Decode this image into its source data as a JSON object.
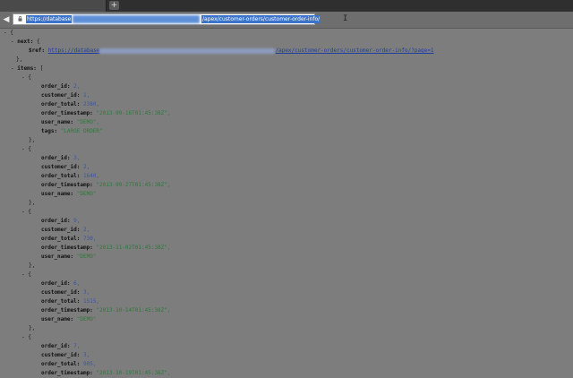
{
  "browser": {
    "new_tab_label": "+",
    "back_label": "◀",
    "url_highlight_start": "https://database",
    "url_highlight_end": "/apex/customer-orders/customer-order-info/"
  },
  "json_view": {
    "toggle_open": "-",
    "open_brace": "{",
    "next_key": "next:",
    "ref_key": "$ref:",
    "ref_prefix": "https://database",
    "ref_suffix": "/apex/customer-orders/customer-order-info/?page=1",
    "close_brace_comma": "},",
    "items_key": "items:",
    "open_bracket": "[",
    "items": [
      {
        "fields": [
          {
            "key": "order_id:",
            "value": "2,",
            "type": "num"
          },
          {
            "key": "customer_id:",
            "value": "1,",
            "type": "num"
          },
          {
            "key": "order_total:",
            "value": "2380,",
            "type": "num"
          },
          {
            "key": "order_timestamp:",
            "value": "\"2013-09-16T01:45:38Z\",",
            "type": "str"
          },
          {
            "key": "user_name:",
            "value": "\"DEMO\",",
            "type": "str"
          },
          {
            "key": "tags:",
            "value": "\"LARGE ORDER\"",
            "type": "str"
          }
        ]
      },
      {
        "fields": [
          {
            "key": "order_id:",
            "value": "3,",
            "type": "num"
          },
          {
            "key": "customer_id:",
            "value": "2,",
            "type": "num"
          },
          {
            "key": "order_total:",
            "value": "1640,",
            "type": "num"
          },
          {
            "key": "order_timestamp:",
            "value": "\"2013-09-27T01:45:38Z\",",
            "type": "str"
          },
          {
            "key": "user_name:",
            "value": "\"DEMO\"",
            "type": "str"
          }
        ]
      },
      {
        "fields": [
          {
            "key": "order_id:",
            "value": "9,",
            "type": "num"
          },
          {
            "key": "customer_id:",
            "value": "2,",
            "type": "num"
          },
          {
            "key": "order_total:",
            "value": "730,",
            "type": "num"
          },
          {
            "key": "order_timestamp:",
            "value": "\"2013-11-02T01:45:38Z\",",
            "type": "str"
          },
          {
            "key": "user_name:",
            "value": "\"DEMO\"",
            "type": "str"
          }
        ]
      },
      {
        "fields": [
          {
            "key": "order_id:",
            "value": "6,",
            "type": "num"
          },
          {
            "key": "customer_id:",
            "value": "3,",
            "type": "num"
          },
          {
            "key": "order_total:",
            "value": "1515,",
            "type": "num"
          },
          {
            "key": "order_timestamp:",
            "value": "\"2013-10-14T01:45:38Z\",",
            "type": "str"
          },
          {
            "key": "user_name:",
            "value": "\"DEMO\"",
            "type": "str"
          }
        ]
      },
      {
        "fields": [
          {
            "key": "order_id:",
            "value": "7,",
            "type": "num"
          },
          {
            "key": "customer_id:",
            "value": "3,",
            "type": "num"
          },
          {
            "key": "order_total:",
            "value": "905,",
            "type": "num"
          },
          {
            "key": "order_timestamp:",
            "value": "\"2013-10-19T01:45:38Z\",",
            "type": "str"
          }
        ]
      }
    ]
  }
}
